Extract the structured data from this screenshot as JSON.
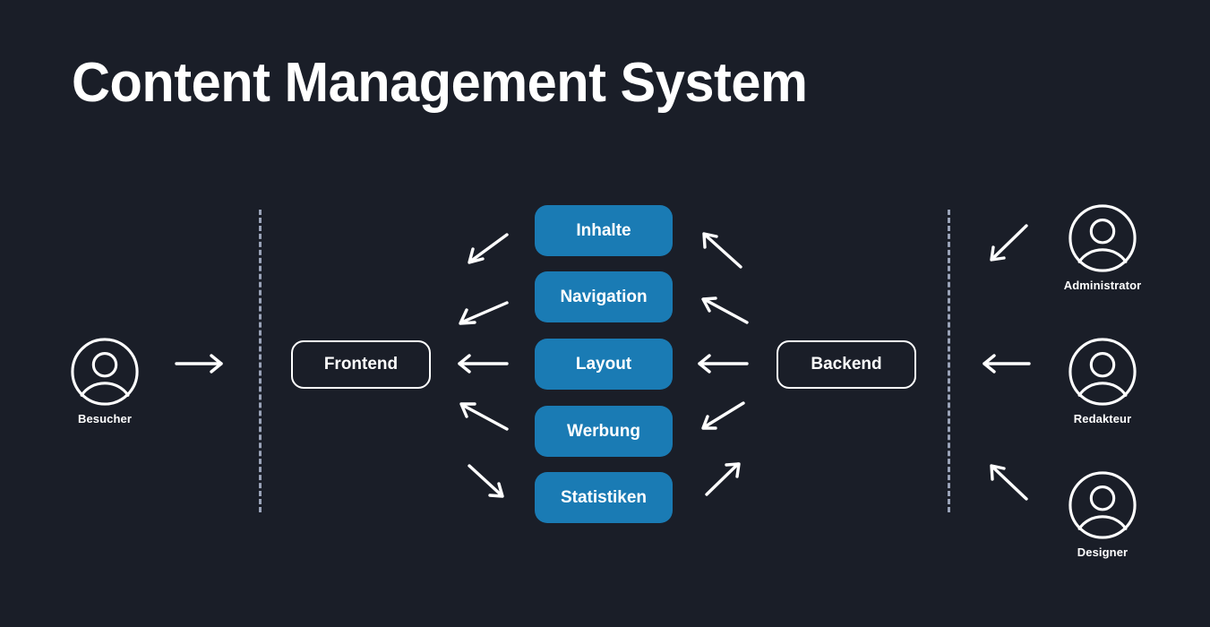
{
  "page": {
    "title": "Content Management System",
    "background_color": "#1a1e28",
    "accent_color": "#1a7bb4",
    "line_color": "#ffffff",
    "divider_color": "#9aa3b8"
  },
  "actors": {
    "visitor": {
      "label": "Besucher",
      "icon": "user-avatar-icon"
    },
    "administrator": {
      "label": "Administrator",
      "icon": "user-avatar-icon"
    },
    "editor": {
      "label": "Redakteur",
      "icon": "user-avatar-icon"
    },
    "designer": {
      "label": "Designer",
      "icon": "user-avatar-icon"
    }
  },
  "layers": {
    "frontend": {
      "label": "Frontend"
    },
    "backend": {
      "label": "Backend"
    }
  },
  "modules": [
    {
      "label": "Inhalte"
    },
    {
      "label": "Navigation"
    },
    {
      "label": "Layout"
    },
    {
      "label": "Werbung"
    },
    {
      "label": "Statistiken"
    }
  ],
  "connections": {
    "visitor_to_frontend": "arrow-right",
    "frontend_from_inhalte": "arrow-down-left",
    "frontend_from_navigation": "arrow-down-left",
    "frontend_from_layout": "arrow-left",
    "frontend_from_werbung": "arrow-up-left",
    "frontend_from_statistiken": "arrow-down-right",
    "backend_to_inhalte": "arrow-up-left",
    "backend_to_navigation": "arrow-up-left",
    "backend_to_layout": "arrow-left",
    "backend_to_werbung": "arrow-down-left",
    "backend_to_statistiken": "arrow-up-right",
    "administrator_to_backend": "arrow-down-left",
    "editor_to_backend": "arrow-left",
    "designer_to_backend": "arrow-up-left"
  }
}
